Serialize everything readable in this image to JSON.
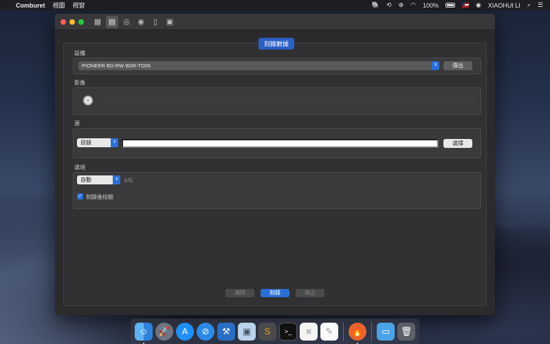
{
  "menubar": {
    "app_name": "Comburet",
    "menus": [
      "視圖",
      "視窗"
    ],
    "battery": "100%",
    "user": "XIAOHUI LI"
  },
  "window": {
    "tab_label": "刻錄數據",
    "device": {
      "label": "設備",
      "selected": "PIONEER BD-RW BDR-TD05",
      "eject_label": "彈出"
    },
    "media": {
      "label": "影像",
      "progress": 0
    },
    "source": {
      "label": "源",
      "type_selected": "目錄",
      "path_value": "",
      "choose_label": "選擇"
    },
    "options": {
      "label": "選項",
      "speed_selected": "自動",
      "speed_unit": "X/S",
      "verify_label": "刻錄後校驗",
      "verify_checked": true
    },
    "buttons": {
      "clear": "清除",
      "burn": "刻錄",
      "stop": "停止"
    }
  },
  "colors": {
    "accent": "#2b6fd6",
    "window_bg": "#2b2b2d"
  },
  "icons": {
    "toolbar": [
      "shop-icon",
      "document-icon",
      "disc-icon",
      "disc-add-icon",
      "file-icon",
      "file-lock-icon"
    ],
    "dock": [
      "finder-icon",
      "launchpad-icon",
      "app-store-icon",
      "safari-icon",
      "xcode-icon",
      "box-icon",
      "sublime-icon",
      "terminal-icon",
      "textedit-icon",
      "pages-icon",
      "comburet-icon",
      "folder-icon",
      "trash-icon"
    ]
  }
}
